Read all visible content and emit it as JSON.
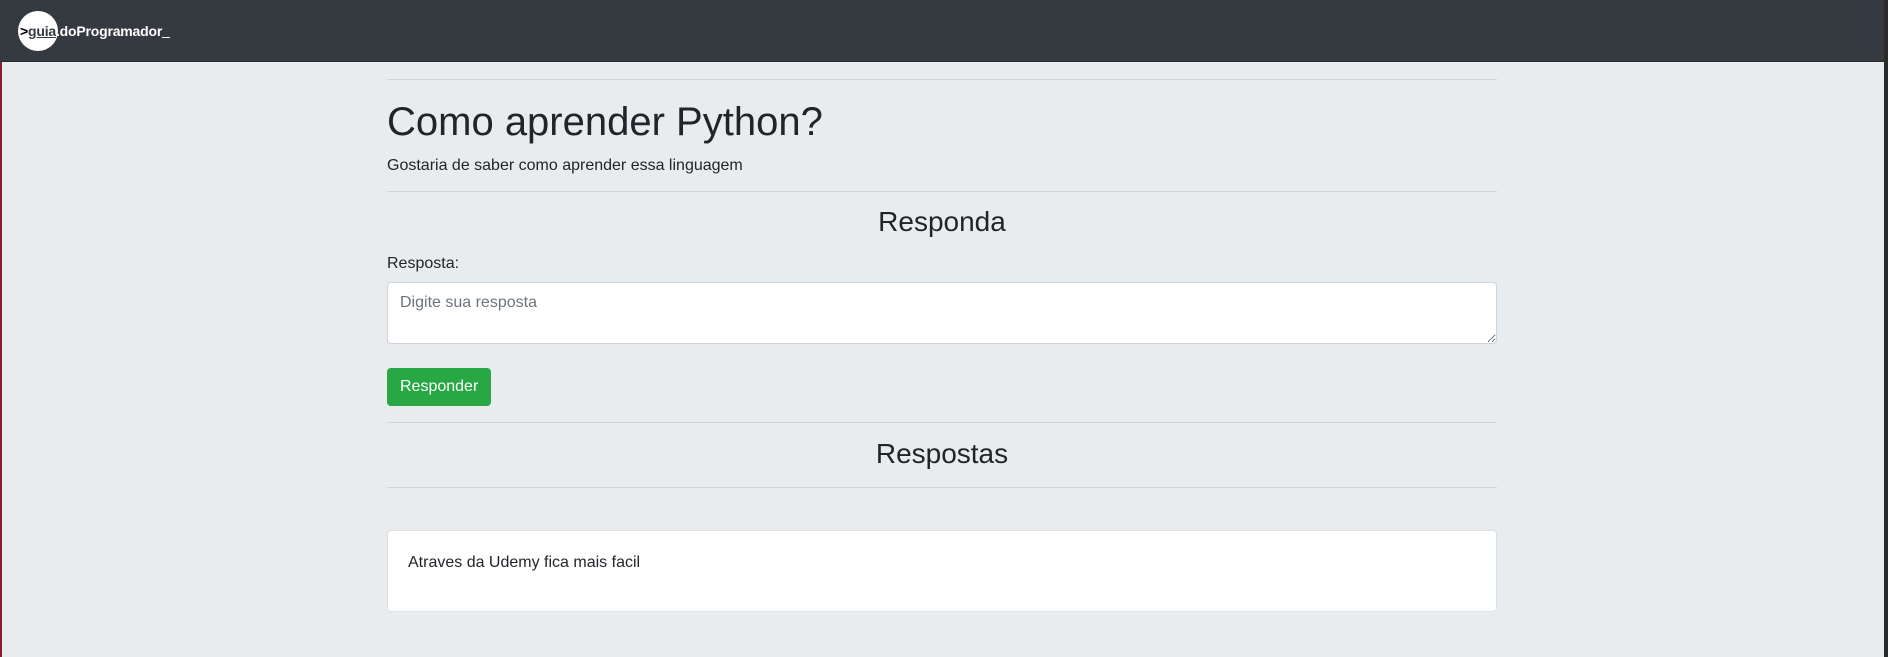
{
  "navbar": {
    "brand": {
      "prefix": ">",
      "guia": "guia",
      "rest": ".doProgramador",
      "cursor": "_"
    }
  },
  "question": {
    "title": "Como aprender Python?",
    "description": "Gostaria de saber como aprender essa linguagem"
  },
  "reply_form": {
    "heading": "Responda",
    "label": "Resposta:",
    "placeholder": "Digite sua resposta",
    "value": "",
    "submit_label": "Responder"
  },
  "answers": {
    "heading": "Respostas",
    "items": [
      {
        "text": "Atraves da Udemy fica mais facil"
      }
    ]
  },
  "colors": {
    "navbar_bg": "#343a40",
    "page_bg": "#e9ecef",
    "success": "#28a745"
  }
}
